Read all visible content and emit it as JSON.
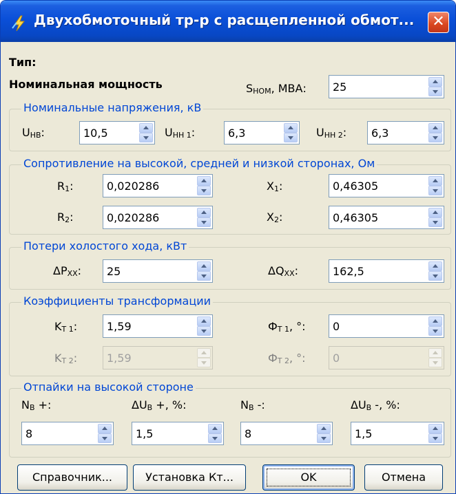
{
  "window": {
    "title": "Двухобмоточный тр-р с расщепленной обмот...",
    "close_label": "✕"
  },
  "type_label": "Тип:",
  "nominal_power": {
    "label": "Номинальная мощность",
    "s_label": "S",
    "s_sub": "НОМ",
    "s_unit": ", МВА:",
    "value": "25"
  },
  "voltages": {
    "legend": "Номинальные напряжения, кВ",
    "unv": {
      "label": "U",
      "sub": "НВ",
      "suffix": ":",
      "value": "10,5"
    },
    "unn1": {
      "label": "U",
      "sub": "НН 1",
      "suffix": ":",
      "value": "6,3"
    },
    "unn2": {
      "label": "U",
      "sub": "НН 2",
      "suffix": ":",
      "value": "6,3"
    }
  },
  "resistance": {
    "legend": "Сопротивление на высокой, средней и низкой сторонах, Ом",
    "r1": {
      "label": "R",
      "sub": "1",
      "suffix": ":",
      "value": "0,020286"
    },
    "x1": {
      "label": "X",
      "sub": "1",
      "suffix": ":",
      "value": "0,46305"
    },
    "r2": {
      "label": "R",
      "sub": "2",
      "suffix": ":",
      "value": "0,020286"
    },
    "x2": {
      "label": "X",
      "sub": "2",
      "suffix": ":",
      "value": "0,46305"
    }
  },
  "losses": {
    "legend": "Потери холостого хода, кВт",
    "dp": {
      "label": "ΔP",
      "sub": "ХХ",
      "suffix": ":",
      "value": "25"
    },
    "dq": {
      "label": "ΔQ",
      "sub": "ХХ",
      "suffix": ":",
      "value": "162,5"
    }
  },
  "ratios": {
    "legend": "Коэффициенты трансформации",
    "kt1": {
      "label": "K",
      "sub": "Т 1",
      "suffix": ":",
      "value": "1,59"
    },
    "ft1": {
      "label": "Ф",
      "sub": "Т 1",
      "suffix": ", °:",
      "value": "0"
    },
    "kt2": {
      "label": "K",
      "sub": "Т 2",
      "suffix": ":",
      "value": "1,59"
    },
    "ft2": {
      "label": "Ф",
      "sub": "Т 2",
      "suffix": ", °:",
      "value": "0"
    }
  },
  "taps": {
    "legend": "Отпайки на высокой стороне",
    "nbp": {
      "label": "N",
      "sub": "В",
      "suffix": " +:",
      "value": "8"
    },
    "dubp": {
      "label": "ΔU",
      "sub": "В",
      "suffix": " +, %:",
      "value": "1,5"
    },
    "nbm": {
      "label": "N",
      "sub": "В",
      "suffix": " -:",
      "value": "8"
    },
    "dubm": {
      "label": "ΔU",
      "sub": "В",
      "suffix": " -, %:",
      "value": "1,5"
    }
  },
  "buttons": {
    "reference": "Справочник...",
    "set_kt": "Установка Кт...",
    "ok": "OK",
    "cancel": "Отмена"
  },
  "colors": {
    "titlebar": "#0a4fd8",
    "dialog_bg": "#ece9d8",
    "group_legend": "#0046d5",
    "close_button": "#d9461f"
  }
}
